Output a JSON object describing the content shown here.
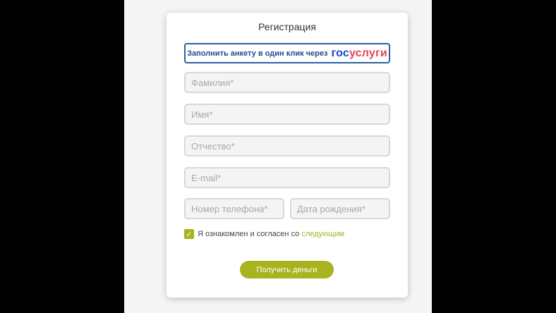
{
  "form": {
    "title": "Регистрация",
    "gosuslugi_text": "Заполнить анкету в один клик через",
    "gosuslugi_logo_part1": "гос",
    "gosuslugi_logo_part2": "услуги",
    "fields": {
      "last_name": "Фамилия*",
      "first_name": "Имя*",
      "middle_name": "Отчество*",
      "email": "E-mail*",
      "phone": "Номер телефона*",
      "birth_date": "Дата рождения*"
    },
    "agreement_text": "Я ознакомлен и согласен со",
    "agreement_link": "следующим",
    "agreement_checked": true,
    "submit_label": "Получить деньги"
  },
  "colors": {
    "accent": "#a7b41e",
    "gosuslugi_blue": "#0d4cd3",
    "gosuslugi_red": "#ee3f58",
    "gosuslugi_border": "#2e5fa8"
  }
}
